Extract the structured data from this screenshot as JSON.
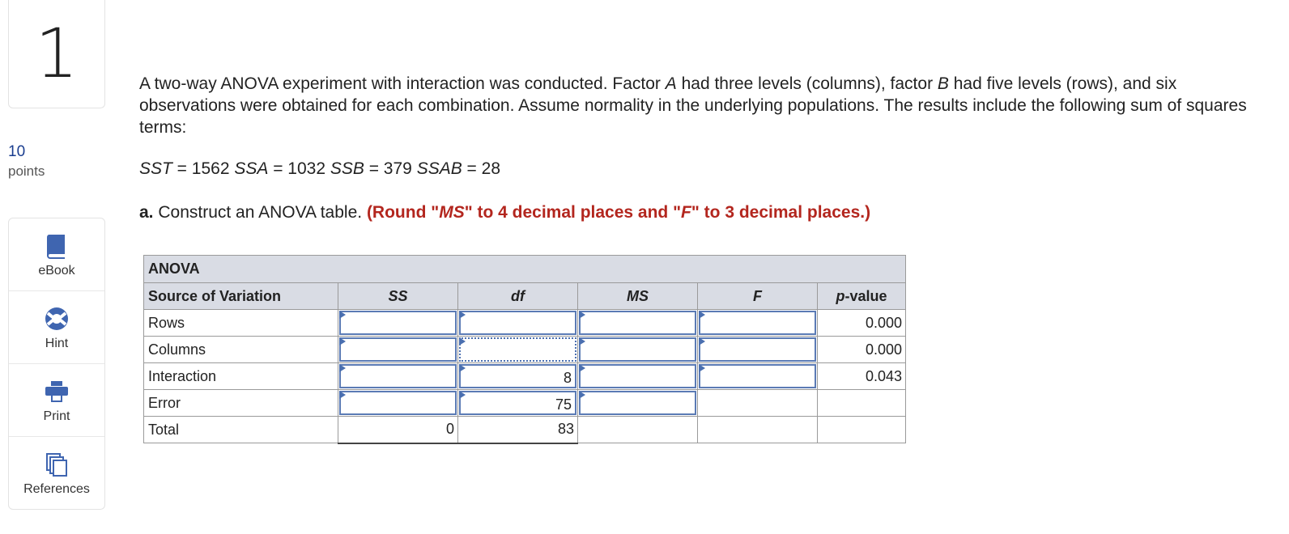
{
  "question": {
    "number": "1",
    "points_value": "10",
    "points_label": "points"
  },
  "tools": [
    {
      "label": "eBook",
      "icon": "book-icon"
    },
    {
      "label": "Hint",
      "icon": "lifebuoy-icon"
    },
    {
      "label": "Print",
      "icon": "printer-icon"
    },
    {
      "label": "References",
      "icon": "documents-icon"
    }
  ],
  "prompt": {
    "p1": "A two-way ANOVA experiment with interaction was conducted. Factor ",
    "factor_a": "A",
    "p2": " had three levels (columns), factor ",
    "factor_b": "B",
    "p3": " had five levels (rows), and six observations were obtained for each combination. Assume normality in the underlying populations. The results include the following sum of squares terms:"
  },
  "equation": {
    "sst_label": "SST",
    "sst_value": " = 1562 ",
    "ssa_label": "SSA",
    "ssa_value": " = 1032 ",
    "ssb_label": "SSB",
    "ssb_value": " = 379 ",
    "ssab_label": "SSAB",
    "ssab_value": " = 28"
  },
  "part_a": {
    "label": "a.",
    "text": " Construct an ANOVA table. ",
    "note_1": "(Round \"",
    "note_ms": "MS",
    "note_2": "\" to 4 decimal places and \"",
    "note_f": "F",
    "note_3": "\" to 3 decimal places.)"
  },
  "anova": {
    "title": "ANOVA",
    "headers": {
      "source": "Source of Variation",
      "ss": "SS",
      "df": "df",
      "ms": "MS",
      "f": "F",
      "p": "p-value"
    },
    "rows": [
      {
        "source": "Rows",
        "ss": "",
        "df": "",
        "ms": "",
        "f": "",
        "p": "0.000"
      },
      {
        "source": "Columns",
        "ss": "",
        "df": "",
        "ms": "",
        "f": "",
        "p": "0.000"
      },
      {
        "source": "Interaction",
        "ss": "",
        "df": "8",
        "ms": "",
        "f": "",
        "p": "0.043"
      },
      {
        "source": "Error",
        "ss": "",
        "df": "75",
        "ms": "",
        "f": "",
        "p": ""
      },
      {
        "source": "Total",
        "ss": "0",
        "df": "83",
        "ms": "",
        "f": "",
        "p": ""
      }
    ]
  }
}
